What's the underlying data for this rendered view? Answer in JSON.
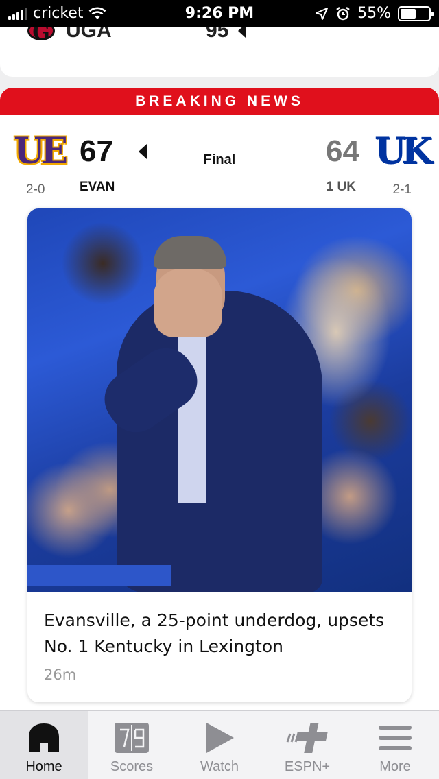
{
  "status_bar": {
    "carrier": "cricket",
    "time": "9:26 PM",
    "battery": "55%",
    "battery_level": 0.55
  },
  "previous_game": {
    "team": "UGA",
    "score": "95"
  },
  "banner": "BREAKING NEWS",
  "game": {
    "home": {
      "abbr": "EVAN",
      "score": "67",
      "record": "2-0",
      "logo": "UE"
    },
    "away": {
      "abbr": "1 UK",
      "score": "64",
      "record": "2-1",
      "logo": "UK"
    },
    "status": "Final"
  },
  "story": {
    "headline": "Evansville, a 25-point underdog, upsets No. 1 Kentucky in Lexington",
    "age": "26m"
  },
  "tabs": [
    {
      "label": "Home",
      "icon": "home-icon",
      "active": true
    },
    {
      "label": "Scores",
      "icon": "scoreboard-icon",
      "active": false
    },
    {
      "label": "Watch",
      "icon": "play-icon",
      "active": false
    },
    {
      "label": "ESPN+",
      "icon": "espn-plus-icon",
      "active": false
    },
    {
      "label": "More",
      "icon": "menu-icon",
      "active": false
    }
  ],
  "colors": {
    "breaking_red": "#e0101c",
    "evansville_purple": "#4b2679",
    "kentucky_blue": "#0033a0"
  }
}
